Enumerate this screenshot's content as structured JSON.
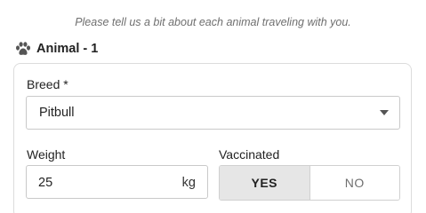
{
  "intro_text": "Please tell us a bit about each animal traveling with you.",
  "animal": {
    "icon": "paw-icon",
    "title": "Animal - 1"
  },
  "breed": {
    "label": "Breed *",
    "value": "Pitbull"
  },
  "weight": {
    "label": "Weight",
    "value": "25",
    "unit": "kg"
  },
  "vaccinated": {
    "label": "Vaccinated",
    "yes": "YES",
    "no": "NO",
    "selected": "YES"
  },
  "colors": {
    "selected_toggle": "#e6e6e6",
    "border": "#c9c9c9"
  }
}
